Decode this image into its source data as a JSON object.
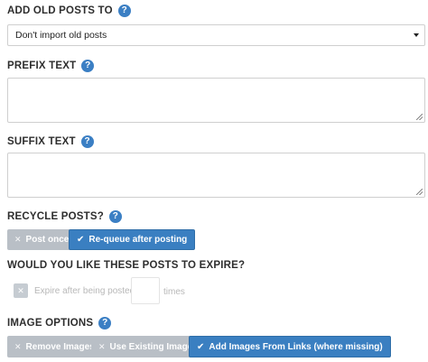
{
  "add_old_posts": {
    "label": "ADD OLD POSTS TO",
    "help": "?",
    "selected": "Don't import old posts"
  },
  "prefix": {
    "label": "PREFIX TEXT",
    "help": "?",
    "value": ""
  },
  "suffix": {
    "label": "SUFFIX TEXT",
    "help": "?",
    "value": ""
  },
  "recycle": {
    "label": "RECYCLE POSTS?",
    "help": "?",
    "options": [
      {
        "label": "Post once",
        "active": false,
        "icon": "x-icon"
      },
      {
        "label": "Re-queue after posting",
        "active": true,
        "icon": "check-icon"
      }
    ]
  },
  "expire": {
    "label": "WOULD YOU LIKE THESE POSTS TO EXPIRE?",
    "checkbox_label": "Expire after being posted",
    "times_value": "",
    "times_suffix": "times"
  },
  "image_options": {
    "label": "IMAGE OPTIONS",
    "help": "?",
    "options": [
      {
        "label": "Remove Images",
        "active": false,
        "icon": "x-icon"
      },
      {
        "label": "Use Existing Images",
        "active": false,
        "icon": "x-icon"
      },
      {
        "label": "Add Images From Links (where missing)",
        "active": true,
        "icon": "check-icon"
      }
    ]
  },
  "icons": {
    "x": "✕",
    "check": "✔"
  },
  "colors": {
    "accent": "#3a7fc1",
    "inactive": "#b9bfc6",
    "help": "#3b7fc4"
  }
}
